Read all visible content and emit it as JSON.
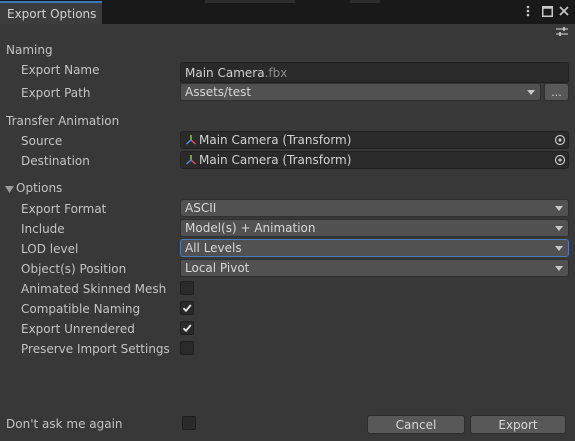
{
  "window": {
    "tab_title": "Export Options",
    "icons": [
      "kebab-menu-icon",
      "maximize-icon",
      "close-icon",
      "settings-sliders-icon"
    ]
  },
  "naming": {
    "section_label": "Naming",
    "export_name_label": "Export Name",
    "export_name_value": "Main Camera",
    "export_name_ext": ".fbx",
    "export_path_label": "Export Path",
    "export_path_value": "Assets/test",
    "browse_label": "..."
  },
  "transfer": {
    "section_label": "Transfer Animation",
    "source_label": "Source",
    "source_value": "Main Camera (Transform)",
    "destination_label": "Destination",
    "destination_value": "Main Camera (Transform)"
  },
  "options": {
    "section_label": "Options",
    "expanded": true,
    "export_format_label": "Export Format",
    "export_format_value": "ASCII",
    "include_label": "Include",
    "include_value": "Model(s) + Animation",
    "lod_label": "LOD level",
    "lod_value": "All Levels",
    "position_label": "Object(s) Position",
    "position_value": "Local Pivot",
    "animated_skinned_mesh_label": "Animated Skinned Mesh",
    "animated_skinned_mesh_checked": false,
    "compatible_naming_label": "Compatible Naming",
    "compatible_naming_checked": true,
    "export_unrendered_label": "Export Unrendered",
    "export_unrendered_checked": true,
    "preserve_import_label": "Preserve Import Settings",
    "preserve_import_checked": false
  },
  "footer": {
    "dont_ask_label": "Don't ask me again",
    "dont_ask_checked": false,
    "cancel_label": "Cancel",
    "export_label": "Export"
  },
  "colors": {
    "background": "#383838",
    "titlebar": "#191919",
    "tab_accent": "#3a79bb",
    "field_bg": "#2a2a2a",
    "dropdown_bg": "#515151",
    "focus_border": "#4a7bb5",
    "text": "#c4c4c4"
  }
}
